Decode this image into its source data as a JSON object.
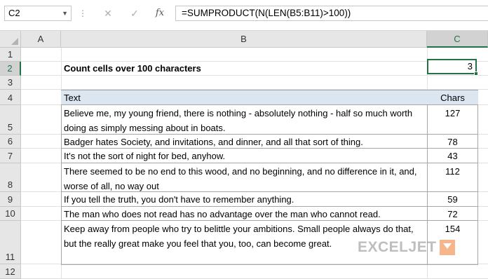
{
  "formula_bar": {
    "name_box": "C2",
    "dots": "⋮",
    "cancel": "✕",
    "enter": "✓",
    "fx": "fx",
    "formula": "=SUMPRODUCT(N(LEN(B5:B11)>100))"
  },
  "columns": [
    "A",
    "B",
    "C"
  ],
  "rows": [
    "1",
    "2",
    "3",
    "4",
    "5",
    "6",
    "7",
    "8",
    "9",
    "10",
    "11",
    "12"
  ],
  "sheet": {
    "title": "Count cells over 100 characters",
    "result": "3",
    "table": {
      "header_text": "Text",
      "header_chars": "Chars",
      "rows": [
        {
          "text": "Believe me, my young friend, there is nothing - absolutely nothing - half so much worth doing as simply messing about in boats.",
          "chars": "127"
        },
        {
          "text": "Badger hates Society, and invitations, and dinner, and all that sort of thing.",
          "chars": "78"
        },
        {
          "text": "It's not the sort of night for bed, anyhow.",
          "chars": "43"
        },
        {
          "text": "There seemed to be no end to this wood, and no beginning, and no difference in it, and, worse of all, no way out",
          "chars": "112"
        },
        {
          "text": "If you tell the truth, you don't have to remember anything.",
          "chars": "59"
        },
        {
          "text": "The man who does not read has no advantage over the man who cannot read.",
          "chars": "72"
        },
        {
          "text": "Keep away from people who try to belittle your ambitions. Small people always do that, but the really great make you feel that you, too, can become great.",
          "chars": "154"
        }
      ]
    }
  },
  "watermark": {
    "text": "EXCELJET",
    "mark_icon": "exceljet-logo-icon"
  },
  "colors": {
    "accent": "#217346",
    "table_header": "#dce6f1",
    "logo": "#f07a2e"
  }
}
